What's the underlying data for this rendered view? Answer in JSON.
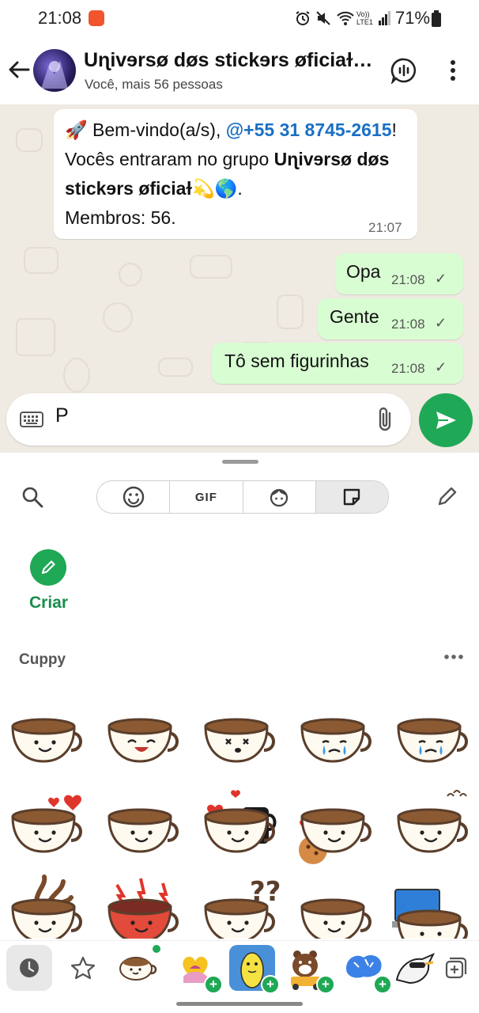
{
  "status_bar": {
    "time": "21:08",
    "network_label": "Vo)) LTE1",
    "battery": "71%"
  },
  "header": {
    "title": "Uɳivɘrsø døs stickɘrs øficiaɫ…",
    "subtitle": "Você, mais 56 pessoas"
  },
  "messages": {
    "welcome": {
      "prefix": " Bem-vindo(a/s), ",
      "mention": "@+55 31 8745-2615",
      "middle": "! Vocês entraram no grupo ",
      "group_name": "Uɳivɘrsø døs stickɘrs øficiaɫ",
      "suffix": ".",
      "members": "Membros: 56.",
      "time": "21:07"
    },
    "outgoing": [
      {
        "text": "Opa",
        "time": "21:08"
      },
      {
        "text": "Gente",
        "time": "21:08"
      },
      {
        "text": "Tô sem figurinhas",
        "time": "21:08"
      }
    ]
  },
  "composer": {
    "value": "P"
  },
  "sticker_panel": {
    "tabs": [
      {
        "name": "emoji",
        "label": ""
      },
      {
        "name": "gif",
        "label": "GIF"
      },
      {
        "name": "avatar",
        "label": ""
      },
      {
        "name": "sticker",
        "label": ""
      }
    ],
    "selected_tab": "sticker",
    "create_label": "Criar",
    "pack_name": "Cuppy"
  },
  "colors": {
    "accent": "#1fa855",
    "outgoing_bubble": "#d9fdd3",
    "chat_background": "#efeae2",
    "link": "#1a6fc4"
  }
}
